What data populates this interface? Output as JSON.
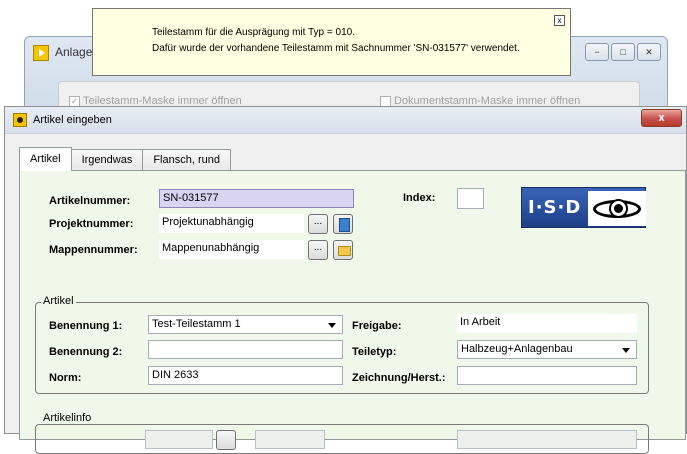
{
  "background_window": {
    "title": "Anlage",
    "controls": [
      "−",
      "□",
      "✕"
    ],
    "check_left": "Teilestamm-Maske immer öffnen",
    "check_right": "Dokumentstamm-Maske immer öffnen",
    "check_left_checked": "✓"
  },
  "tooltip": {
    "line1": "Teilestamm für die Ausprägung mit Typ = 010.",
    "line2": "Dafür wurde der vorhandene Teilestamm mit Sachnummer 'SN-031577' verwendet.",
    "close": "x"
  },
  "dialog": {
    "title": "Artikel eingeben",
    "close": "x",
    "tabs": [
      "Artikel",
      "Irgendwas",
      "Flansch, rund"
    ],
    "header": {
      "artikelnummer_label": "Artikelnummer:",
      "artikelnummer_value": "SN-031577",
      "projektnummer_label": "Projektnummer:",
      "projektnummer_value": "Projektunabhängig",
      "mappennummer_label": "Mappennummer:",
      "mappennummer_value": "Mappenunabhängig",
      "index_label": "Index:",
      "index_value": "",
      "ellipsis": "..."
    },
    "logo": {
      "text": "I·S·D",
      "icon": "isd-eye-logo"
    },
    "artikel_group": {
      "title": "Artikel",
      "benennung1_label": "Benennung 1:",
      "benennung1_value": "Test-Teilestamm 1",
      "benennung2_label": "Benennung 2:",
      "benennung2_value": "",
      "norm_label": "Norm:",
      "norm_value": "DIN 2633",
      "freigabe_label": "Freigabe:",
      "freigabe_value": "In Arbeit",
      "teiletyp_label": "Teiletyp:",
      "teiletyp_value": "Halbzeug+Anlagenbau",
      "zeichnung_label": "Zeichnung/Herst.:",
      "zeichnung_value": ""
    },
    "artikelinfo_group": {
      "title": "Artikelinfo"
    }
  }
}
